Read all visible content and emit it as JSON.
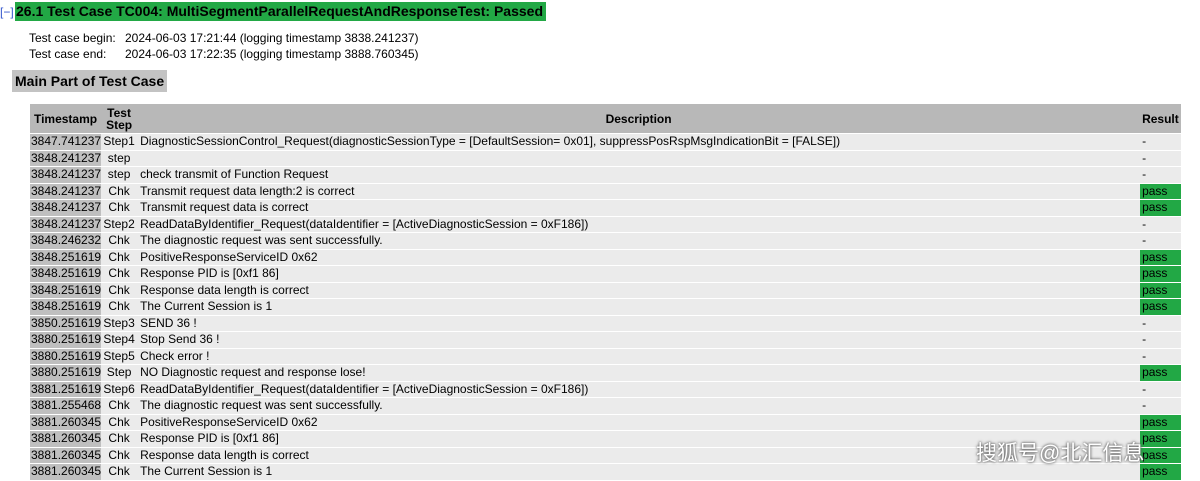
{
  "toggle_label": "[−]",
  "title": "26.1 Test Case TC004: MultiSegmentParallelRequestAndResponseTest: Passed",
  "meta": {
    "begin_label": "Test case begin:",
    "begin_value": "2024-06-03 17:21:44  (logging timestamp 3838.241237)",
    "end_label": "Test case end:",
    "end_value": "2024-06-03 17:22:35  (logging timestamp 3888.760345)"
  },
  "section_title": "Main Part of Test Case",
  "table": {
    "headers": [
      "Timestamp",
      "Test Step",
      "Description",
      "Result"
    ],
    "rows": [
      {
        "ts": "3847.741237",
        "step": "Step1",
        "desc": "DiagnosticSessionControl_Request(diagnosticSessionType = [DefaultSession= 0x01], suppressPosRspMsgIndicationBit = [FALSE])",
        "result": "-"
      },
      {
        "ts": "3848.241237",
        "step": "step",
        "desc": "",
        "result": "-"
      },
      {
        "ts": "3848.241237",
        "step": "step",
        "desc": "check transmit of Function Request",
        "result": "-"
      },
      {
        "ts": "3848.241237",
        "step": "Chk",
        "desc": "Transmit request data length:2 is correct",
        "result": "pass"
      },
      {
        "ts": "3848.241237",
        "step": "Chk",
        "desc": "Transmit request data is correct",
        "result": "pass"
      },
      {
        "ts": "3848.241237",
        "step": "Step2",
        "desc": "ReadDataByIdentifier_Request(dataIdentifier = [ActiveDiagnosticSession = 0xF186])",
        "result": "-"
      },
      {
        "ts": "3848.246232",
        "step": "Chk",
        "desc": "The diagnostic request was sent successfully.",
        "result": "-"
      },
      {
        "ts": "3848.251619",
        "step": "Chk",
        "desc": "PositiveResponseServiceID 0x62",
        "result": "pass"
      },
      {
        "ts": "3848.251619",
        "step": "Chk",
        "desc": "Response PID is [0xf1 86]",
        "result": "pass"
      },
      {
        "ts": "3848.251619",
        "step": "Chk",
        "desc": "Response data length is correct",
        "result": "pass"
      },
      {
        "ts": "3848.251619",
        "step": "Chk",
        "desc": "The Current Session is 1",
        "result": "pass"
      },
      {
        "ts": "3850.251619",
        "step": "Step3",
        "desc": "SEND 36 !",
        "result": "-"
      },
      {
        "ts": "3880.251619",
        "step": "Step4",
        "desc": "Stop Send 36 !",
        "result": "-"
      },
      {
        "ts": "3880.251619",
        "step": "Step5",
        "desc": "Check error !",
        "result": "-"
      },
      {
        "ts": "3880.251619",
        "step": "Step",
        "desc": "NO Diagnostic request and response lose!",
        "result": "pass"
      },
      {
        "ts": "3881.251619",
        "step": "Step6",
        "desc": "ReadDataByIdentifier_Request(dataIdentifier = [ActiveDiagnosticSession = 0xF186])",
        "result": "-"
      },
      {
        "ts": "3881.255468",
        "step": "Chk",
        "desc": "The diagnostic request was sent successfully.",
        "result": "-"
      },
      {
        "ts": "3881.260345",
        "step": "Chk",
        "desc": "PositiveResponseServiceID 0x62",
        "result": "pass"
      },
      {
        "ts": "3881.260345",
        "step": "Chk",
        "desc": "Response PID is [0xf1 86]",
        "result": "pass"
      },
      {
        "ts": "3881.260345",
        "step": "Chk",
        "desc": "Response data length is correct",
        "result": "pass"
      },
      {
        "ts": "3881.260345",
        "step": "Chk",
        "desc": "The Current Session is 1",
        "result": "pass"
      }
    ]
  },
  "colors": {
    "pass": "#22a845",
    "header": "#b8b8b8",
    "timestamp": "#bfbfbf",
    "row": "#ebebeb"
  },
  "watermark": "搜狐号@北汇信息"
}
